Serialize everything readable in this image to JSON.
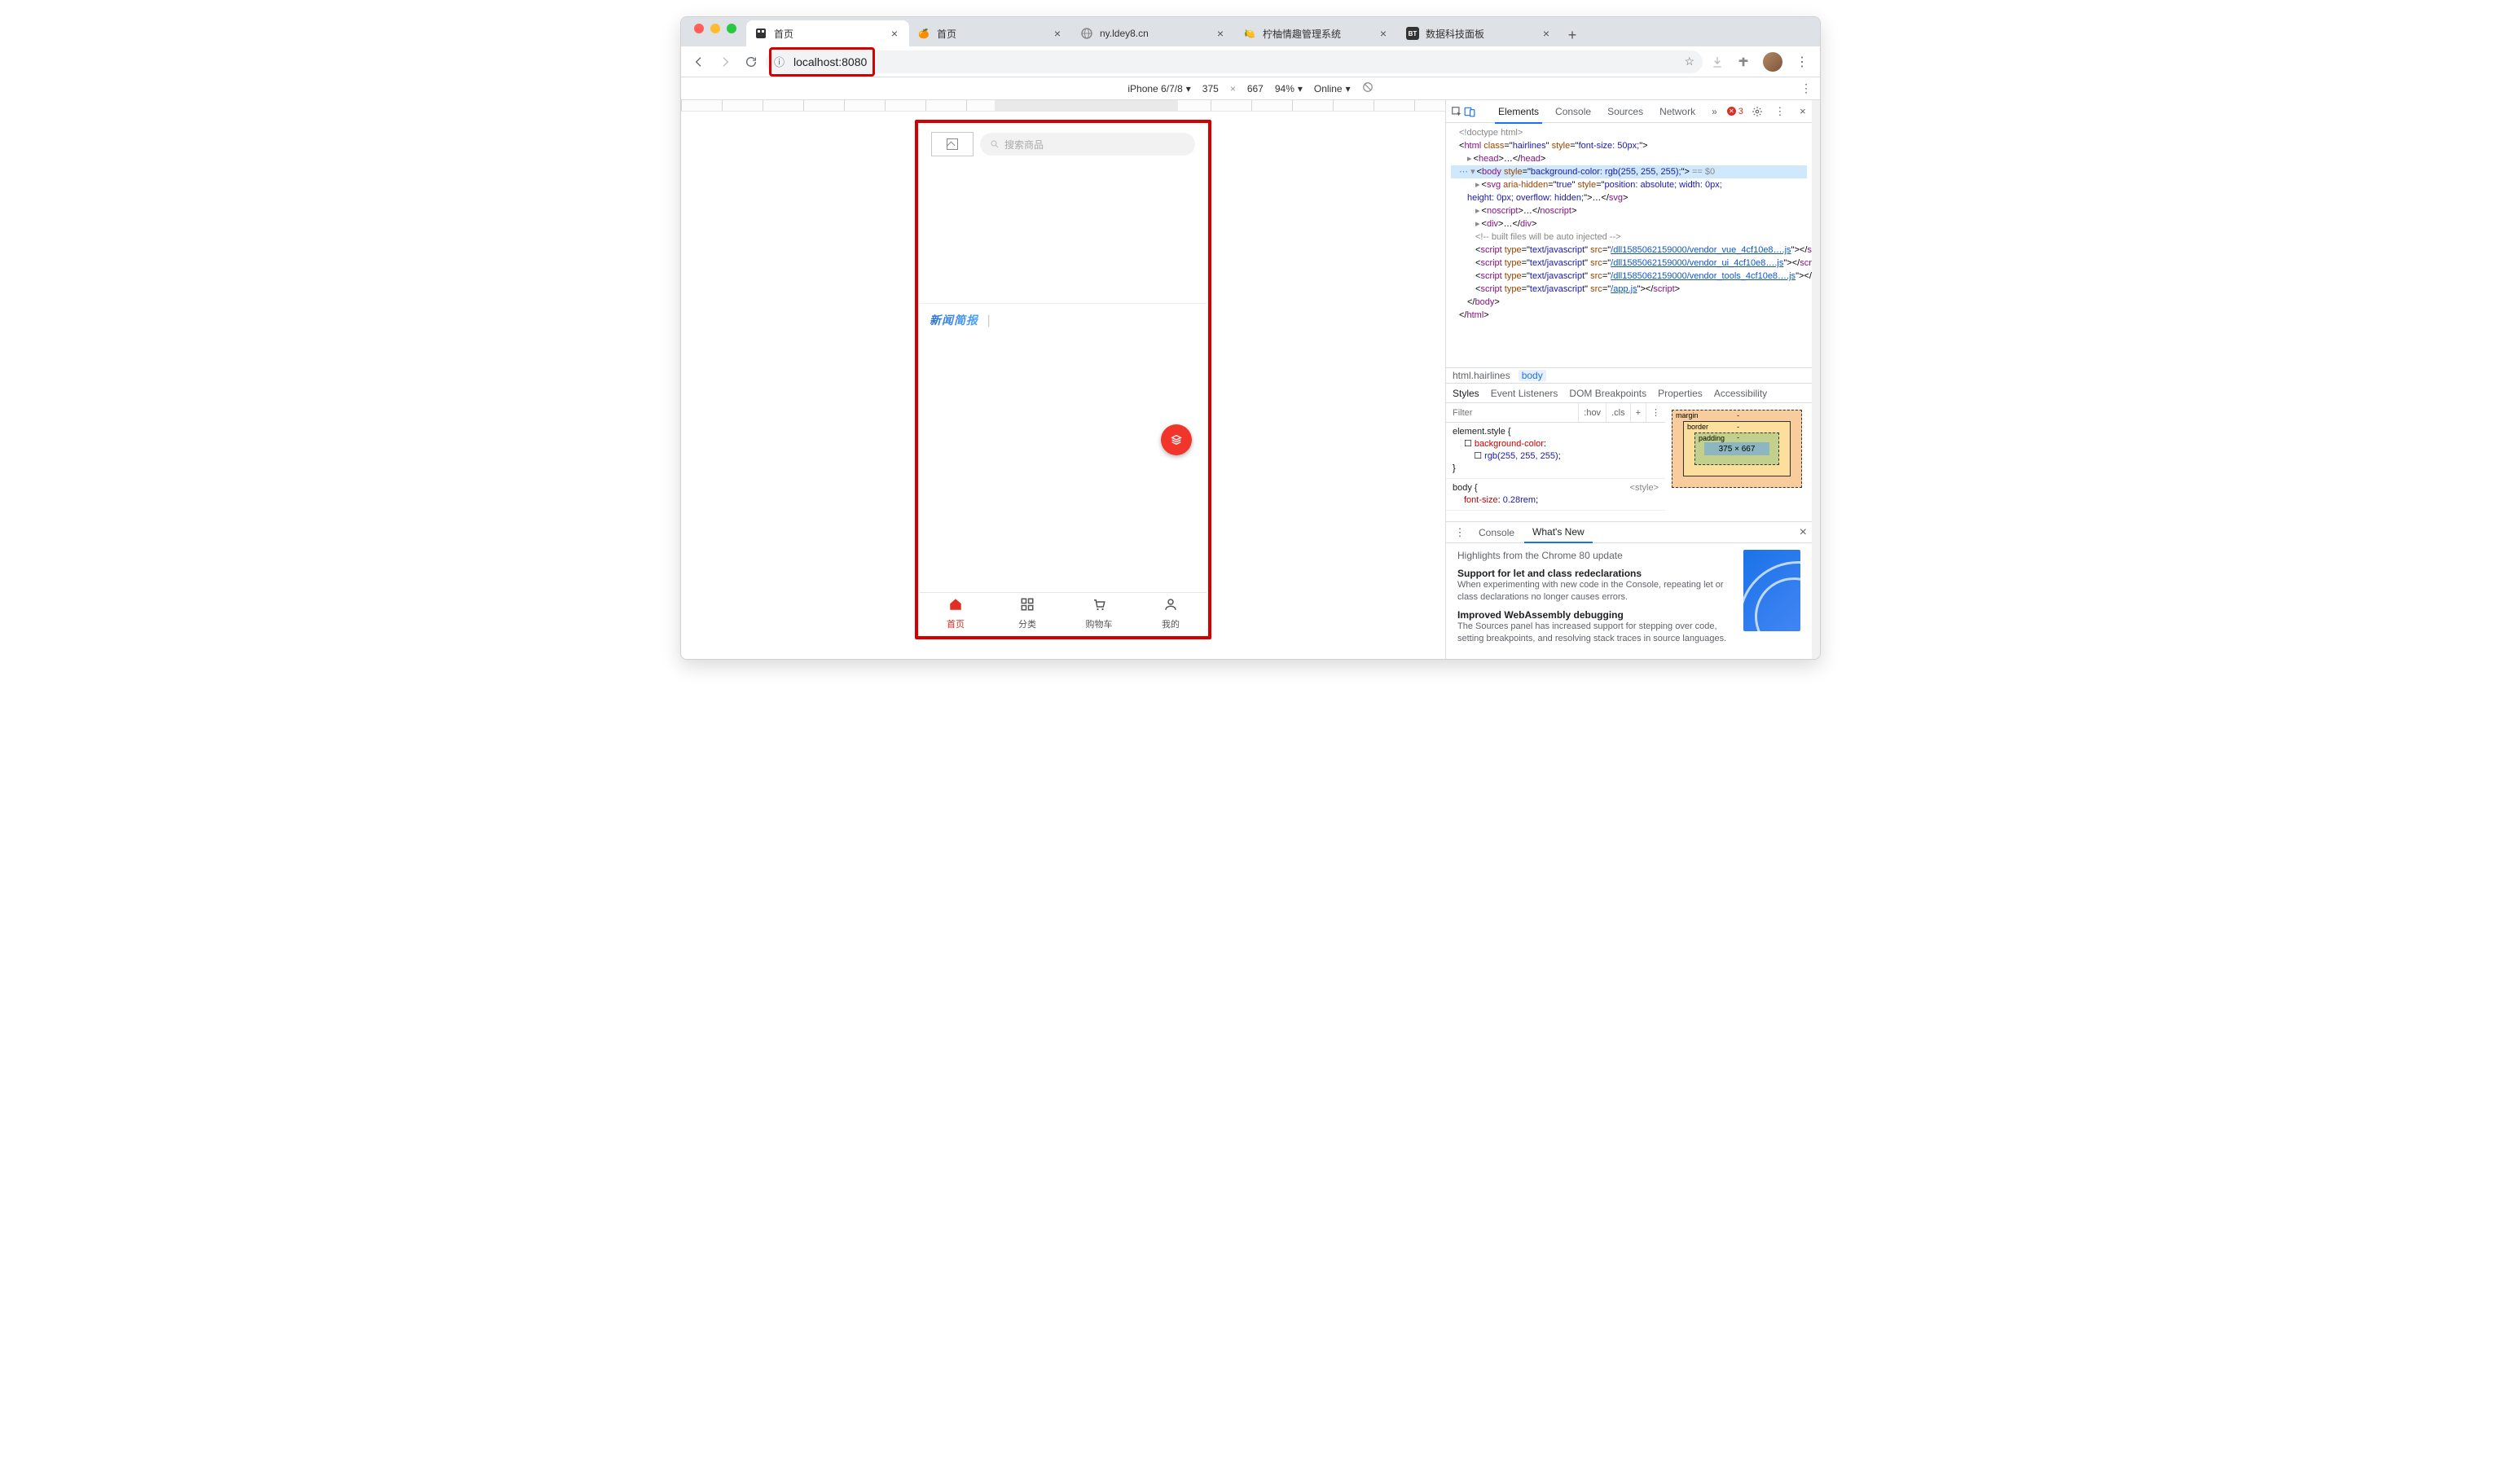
{
  "window": {
    "tabs": [
      {
        "title": "首页",
        "active": true,
        "favicon": "🟫"
      },
      {
        "title": "首页",
        "active": false,
        "favicon": "🍊"
      },
      {
        "title": "ny.ldey8.cn",
        "active": false,
        "favicon": "🌐"
      },
      {
        "title": "柠柚情趣管理系统",
        "active": false,
        "favicon": "🍋"
      },
      {
        "title": "数据科技面板",
        "active": false,
        "favicon": "BT"
      }
    ],
    "url": "localhost:8080"
  },
  "deviceToolbar": {
    "device": "iPhone 6/7/8",
    "width": "375",
    "height": "667",
    "zoom": "94%",
    "throttle": "Online"
  },
  "mobileApp": {
    "searchPlaceholder": "搜索商品",
    "newsSection": "新闻简报",
    "tabs": [
      {
        "label": "首页",
        "active": true
      },
      {
        "label": "分类",
        "active": false
      },
      {
        "label": "购物车",
        "active": false
      },
      {
        "label": "我的",
        "active": false
      }
    ]
  },
  "devtools": {
    "panels": [
      "Elements",
      "Console",
      "Sources",
      "Network"
    ],
    "activePanel": "Elements",
    "moreIndicator": "»",
    "errorCount": "3",
    "dom": {
      "doctype": "<!doctype html>",
      "htmlOpen": {
        "class": "hairlines",
        "style": "font-size: 50px;"
      },
      "headCollapsed": "<head>…</head>",
      "bodyStyle": "background-color: rgb(255, 255, 255);",
      "bodyEq": "== $0",
      "svgLine": "<svg aria-hidden=\"true\" style=\"position: absolute; width: 0px; height: 0px; overflow: hidden;\">…</svg>",
      "noscript": "<noscript>…</noscript>",
      "div": "<div>…</div>",
      "comment": "<!-- built files will be auto injected -->",
      "scripts": [
        {
          "src": "/dll1585062159000/vendor_vue_4cf10e8….js"
        },
        {
          "src": "/dll1585062159000/vendor_ui_4cf10e8….js"
        },
        {
          "src": "/dll1585062159000/vendor_tools_4cf10e8….js"
        },
        {
          "src": "/app.js"
        }
      ]
    },
    "breadcrumb": [
      "html.hairlines",
      "body"
    ],
    "stylesTabs": [
      "Styles",
      "Event Listeners",
      "DOM Breakpoints",
      "Properties",
      "Accessibility"
    ],
    "filterPlaceholder": "Filter",
    "filterButtons": [
      ":hov",
      ".cls",
      "+"
    ],
    "cssRules": [
      {
        "selector": "element.style {",
        "props": [
          {
            "k": "background-color",
            "v": "rgb(255, 255, 255)"
          }
        ],
        "close": "}"
      },
      {
        "selector": "body {",
        "src": "<style>",
        "props": [
          {
            "k": "font-size",
            "v": "0.28rem"
          }
        ]
      }
    ],
    "boxModel": {
      "margin": "margin",
      "border": "border",
      "padding": "padding",
      "content": "375 × 667"
    },
    "drawer": {
      "tabs": [
        "Console",
        "What's New"
      ],
      "active": "What's New",
      "headline": "Highlights from the Chrome 80 update",
      "items": [
        {
          "title": "Support for let and class redeclarations",
          "desc": "When experimenting with new code in the Console, repeating let or class declarations no longer causes errors."
        },
        {
          "title": "Improved WebAssembly debugging",
          "desc": "The Sources panel has increased support for stepping over code, setting breakpoints, and resolving stack traces in source languages."
        }
      ]
    }
  }
}
